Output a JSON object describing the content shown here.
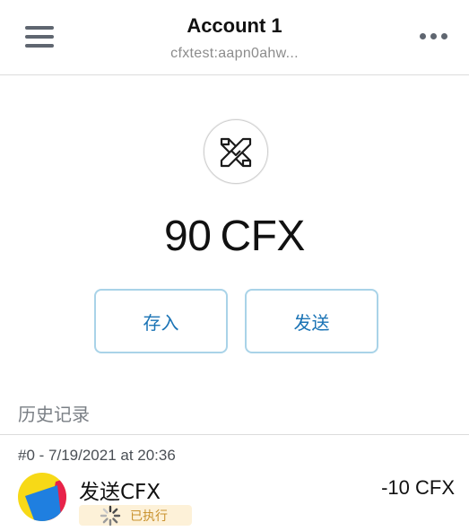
{
  "header": {
    "account_name": "Account 1",
    "address": "cfxtest:aapn0ahw..."
  },
  "icons": {
    "menu": "hamburger-menu-icon",
    "more": "more-horizontal-icon",
    "token": "conflux-logo-icon",
    "spinner": "loading-spinner-icon"
  },
  "balance": {
    "amount": "90",
    "unit": "CFX"
  },
  "actions": {
    "deposit_label": "存入",
    "send_label": "发送"
  },
  "history": {
    "heading": "历史记录",
    "transactions": [
      {
        "meta": "#0 - 7/19/2021 at 20:36",
        "title": "发送CFX",
        "amount": "-10 CFX",
        "status": "已执行"
      }
    ]
  },
  "colors": {
    "button_border": "#a9d3e8",
    "button_text": "#1a73b5",
    "status_bg": "#fdf1d8",
    "status_text": "#c9922e",
    "avatar_yellow": "#f7d917",
    "avatar_blue": "#1f7fe0",
    "avatar_red": "#e8224a"
  }
}
